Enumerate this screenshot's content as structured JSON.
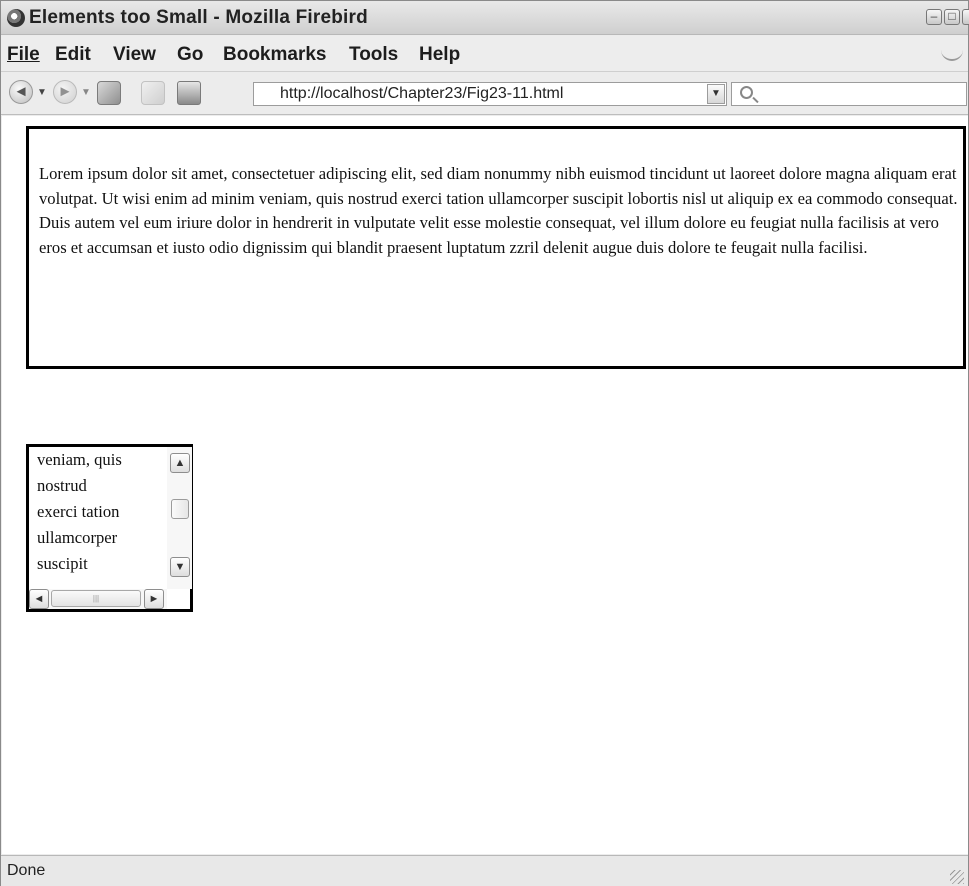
{
  "window": {
    "title": "Elements too Small - Mozilla Firebird"
  },
  "menu": {
    "items": [
      {
        "label": "File"
      },
      {
        "label": "Edit"
      },
      {
        "label": "View"
      },
      {
        "label": "Go"
      },
      {
        "label": "Bookmarks"
      },
      {
        "label": "Tools"
      },
      {
        "label": "Help"
      }
    ]
  },
  "toolbar": {
    "url": "http://localhost/Chapter23/Fig23-11.html",
    "search_placeholder": ""
  },
  "content": {
    "paragraph": "Lorem ipsum dolor sit amet, consectetuer adipiscing elit, sed diam nonummy nibh euismod tincidunt ut laoreet dolore magna aliquam erat volutpat. Ut wisi enim ad minim veniam, quis nostrud exerci tation ullamcorper suscipit lobortis nisl ut aliquip ex ea commodo consequat. Duis autem vel eum iriure dolor in hendrerit in vulputate velit esse molestie consequat, vel illum dolore eu feugiat nulla facilisis at vero eros et accumsan et iusto odio dignissim qui blandit praesent luptatum zzril delenit augue duis dolore te feugait nulla facilisi.",
    "small_box_lines": [
      "veniam, quis",
      "nostrud",
      "exerci tation",
      "ullamcorper",
      "suscipit"
    ]
  },
  "status": {
    "text": "Done"
  },
  "icons": {
    "back": "back-icon",
    "forward": "forward-icon",
    "reload": "reload-icon",
    "stop": "stop-icon",
    "home": "home-icon",
    "search": "search-icon"
  }
}
